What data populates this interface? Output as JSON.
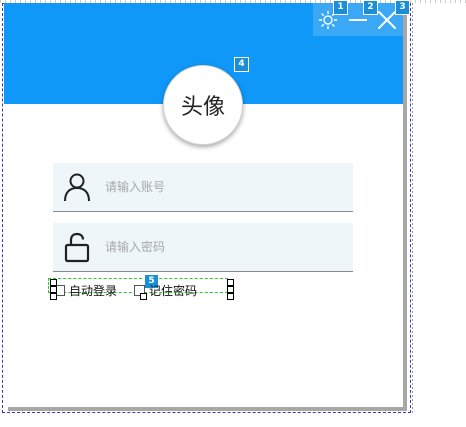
{
  "window": {
    "header_color": "#0f98f7",
    "controls": [
      {
        "icon": "sun-icon",
        "badge": "1"
      },
      {
        "icon": "minimize-icon",
        "badge": "2"
      },
      {
        "icon": "close-icon",
        "badge": "3"
      }
    ]
  },
  "avatar": {
    "label": "头像",
    "badge": "4"
  },
  "form": {
    "account": {
      "icon": "user-icon",
      "placeholder": "请输入账号",
      "value": ""
    },
    "password": {
      "icon": "lock-icon",
      "placeholder": "请输入密码",
      "value": ""
    }
  },
  "options": {
    "badge": "5",
    "auto_login": {
      "label": "自动登录",
      "checked": false
    },
    "remember_password": {
      "label": "记住密码",
      "checked": false
    }
  }
}
